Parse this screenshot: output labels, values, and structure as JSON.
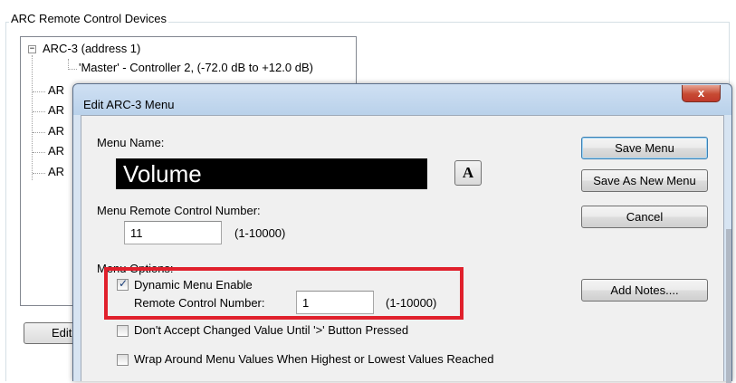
{
  "background": {
    "group_title": "ARC Remote Control Devices",
    "tree": {
      "root": {
        "expander": "−",
        "label": "ARC-3 (address 1)"
      },
      "child": {
        "label": "'Master' - Controller 2, (-72.0 dB to +12.0 dB)"
      },
      "siblings": [
        "AR",
        "AR",
        "AR",
        "AR",
        "AR"
      ]
    },
    "edit_button_label": "Edit"
  },
  "dialog": {
    "title": "Edit ARC-3 Menu",
    "close_glyph": "x",
    "menu_name_label": "Menu Name:",
    "menu_name_value": "Volume",
    "font_button_label": "A",
    "remote_number_label": "Menu Remote Control Number:",
    "remote_number_value": "11",
    "remote_number_range": "(1-10000)",
    "options_label": "Menu Options:",
    "dynamic_enable": {
      "label": "Dynamic Menu Enable",
      "checked": true
    },
    "dynamic_remote_label": "Remote Control Number:",
    "dynamic_remote_value": "1",
    "dynamic_remote_range": "(1-10000)",
    "dont_accept": {
      "label": "Don't Accept Changed Value Until '>' Button Pressed",
      "checked": false
    },
    "wrap_around": {
      "label": "Wrap Around Menu Values When Highest or Lowest Values Reached",
      "checked": false
    },
    "buttons": {
      "save": "Save Menu",
      "save_as_new": "Save As New Menu",
      "cancel": "Cancel",
      "add_notes": "Add Notes...."
    },
    "check_glyph": "✓"
  },
  "colors": {
    "highlight": "#e0202c",
    "dialog_frame": "#d7e4f2",
    "close_button": "#c74a33"
  }
}
